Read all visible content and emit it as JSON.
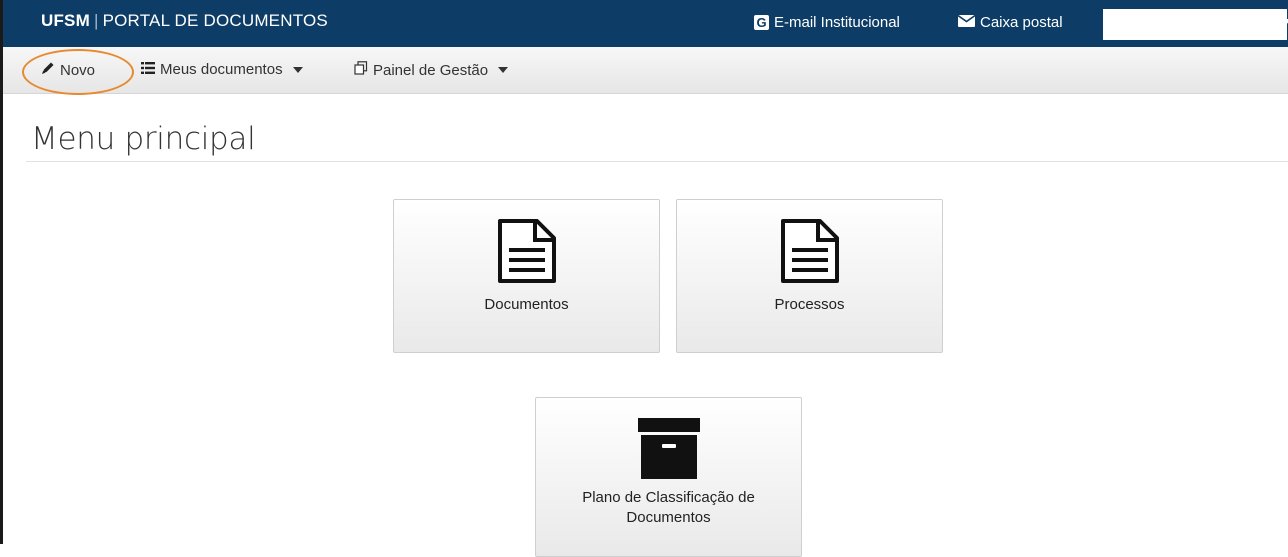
{
  "header": {
    "brand_bold": "UFSM",
    "brand_separator": "|",
    "brand_rest": "PORTAL DE DOCUMENTOS",
    "email_label": "E-mail Institucional",
    "mailbox_label": "Caixa postal",
    "search_value": ""
  },
  "nav": {
    "novo": "Novo",
    "meus_documentos": "Meus documentos",
    "painel_gestao": "Painel de Gestão"
  },
  "page": {
    "title": "Menu principal"
  },
  "tiles": [
    {
      "label": "Documentos",
      "icon": "document-icon"
    },
    {
      "label": "Processos",
      "icon": "document-icon"
    },
    {
      "label": "Plano de Classificação de Documentos",
      "icon": "archive-box-icon"
    }
  ],
  "colors": {
    "topbar": "#0d3d66",
    "highlight": "#e8892f"
  }
}
